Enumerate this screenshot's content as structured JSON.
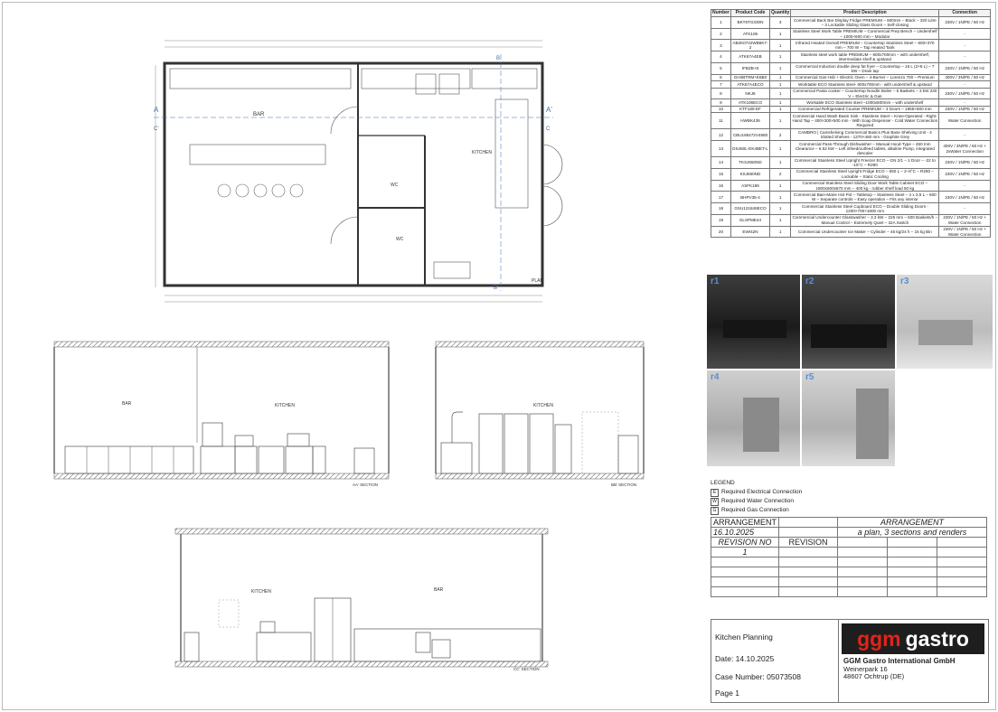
{
  "plan": {
    "label_plan": "PLAN",
    "zone_bar": "BAR",
    "zone_kitchen": "KITCHEN",
    "zone_wc1": "WC",
    "zone_wc2": "WC",
    "section_a": "A",
    "section_a2": "A'",
    "section_b": "B",
    "section_b2": "B'",
    "section_c": "C",
    "section_c2": "C'"
  },
  "sections": {
    "aa_label": "AA' SECTION",
    "aa_bar": "BAR",
    "aa_kitchen": "KITCHEN",
    "bb_label": "BB' SECTION",
    "bb_kitchen": "KITCHEN",
    "cc_label": "CC' SECTION",
    "cc_kitchen": "KITCHEN",
    "cc_bar": "BAR"
  },
  "product_table": {
    "headers": [
      "Number",
      "Product Code",
      "Quantity",
      "Product Description",
      "Connection"
    ],
    "rows": [
      [
        "1",
        "BKT6TG330N",
        "3",
        "Commercial Back Bar Display Fridge PREMIUM – 600mm – Black – 320 Litre – 3 Lockable Sliding Glass Doors – Self-closing",
        "230V / 1N/PE / 50 Hz"
      ],
      [
        "2",
        "ATK106",
        "1",
        "Stainless Steel Work Table PREMIUM – Commercial Prep Bench – Undershelf – 1000×600 mm – Modular",
        "-"
      ],
      [
        "3",
        "AB2K0742WB6K7-2",
        "1",
        "Infrared Heated Overall PREMIUM – Countertop Stainless Steel – 600×370 mm – 700 W – Tap Heated Tank",
        "-"
      ],
      [
        "4",
        "ATK67A4EB",
        "1",
        "Stainless steel work table PREMIUM – 600x700mm – with undershelf, intermediate shelf & upstand",
        "-"
      ],
      [
        "5",
        "IFBZB+8",
        "1",
        "Commercial Induction double deep fat fryer – Countertop – 16 L (2×8 L) – 7 kW – Drain tap",
        "230V / 1N/PE / 50 Hz"
      ],
      [
        "6",
        "GH4BTRM+E6B0",
        "1",
        "Commercial Gas Hob + Electric Oven – 4-Burner – Lorenzo 700 – Premium",
        "400V / 3N/PE / 50 Hz"
      ],
      [
        "7",
        "ATK67A4ECO",
        "1",
        "Worktable ECO Stainless steel- 600x700mm - with undershelf & upstand",
        "-"
      ],
      [
        "8",
        "NKJ6",
        "1",
        "Commercial Pasta cooker – Countertop Noodle Boiler – 6 Baskets – 3 kW 230 V – Electric & Gas",
        "230V / 1N/PE / 50 Hz"
      ],
      [
        "9",
        "ATK106ECO",
        "1",
        "Workable ECO Stainless steel –1000x600mm – with undershelf",
        "-"
      ],
      [
        "10",
        "KTF180-EF",
        "1",
        "Commercial Refrigerated Counter PREMIUM – 3 Doors – 1865×600 mm",
        "230V / 1N/PE / 50 Hz"
      ],
      [
        "11",
        "HWBK439",
        "1",
        "Commercial Hand Wash Basin Sink - Stainless Steel – Knee-Operated - Right-Hand Tap – 400×300×500 mm - With Soap Dispenser - Cold Water Connection Required",
        "Water Connection"
      ],
      [
        "12",
        "CBU185472V4580",
        "2",
        "CAMBRO | Camshelving Commercial Basics Plus Base Shelving Unit - 4 Slotted Shelves - 1370×460 mm - Graphite Grey",
        "-"
      ],
      [
        "13",
        "DS450L-EK4BET-L",
        "1",
        "Commercial Pass-Through Dishwasher – Manual Hood-Type – 450 mm Clearance – 6.52 kW – Left infeed/outfeed tables, alkaline Pump, integrated descaler",
        "400V / 3N/PE / 50 Hz + 2xWater Connection"
      ],
      [
        "14",
        "TKSJ650ND",
        "1",
        "Commercial Stainless Steel Upright Freezer ECO – GN 2/1 – 1 Door – -22 to -15°C – R290",
        "230V / 1N/PE / 50 Hz"
      ],
      [
        "15",
        "KSJ650ND",
        "2",
        "Commercial Stainless Steel Upright Fridge ECO – 650 L – 2–8°C – R290 – Lockable – Static Cooling",
        "230V / 1N/PE / 50 Hz"
      ],
      [
        "16",
        "ASFK186",
        "1",
        "Commercial Stainless Steel Sliding Door Work Table Cabinet ECO – 1800x600x870 mm – 400 kg - rubber shelf load 50 kg",
        "-"
      ],
      [
        "17",
        "BHPV35-4",
        "1",
        "Commercial Bain-Marie Hot Pot – Tabletop – Stainless Steel – 4 x 3.5 L – 600 W – Separate controls – Easy operation – Fits any interior",
        "230V / 1N/PE / 50 Hz"
      ],
      [
        "18",
        "GSU121846ECO",
        "1",
        "Commercial Stainless Steel Cupboard ECO – Double Sliding Doors - 1200×700×1800 mm",
        "-"
      ],
      [
        "19",
        "GLSPME44",
        "1",
        "Commercial Undercounter Glasswasher – 3.3 kW – 225 mm – 500 Baskets/h – Manual Control – Extremely Quiet – 32A Switch",
        "230V / 1N/PE / 50 Hz + Water Connection"
      ],
      [
        "20",
        "EWI42N",
        "1",
        "Commercial Undercounter Ice Maker – Cylinder – 46 kg/24 h – 15 kg Bin",
        "230V / 1N/PE / 50 Hz + Water Connection"
      ]
    ]
  },
  "renders": [
    "r1",
    "r2",
    "r3",
    "r4",
    "r5"
  ],
  "legend": {
    "title": "LEGEND",
    "items": [
      {
        "symbol": "E",
        "label": "Required Electrical Connection"
      },
      {
        "symbol": "W",
        "label": "Required Water Connection"
      },
      {
        "symbol": "G",
        "label": "Required Gas Connection"
      }
    ]
  },
  "arrangement": {
    "title_left": "ARRANGEMENT",
    "title_right": "ARRANGEMENT",
    "date": "16.10.2025",
    "description": "a plan, 3 sections and renders",
    "revision_no_header": "REVISION NO",
    "revision_header": "REVISION",
    "revision_no": "1"
  },
  "title_block": {
    "project": "Kitchen Planning",
    "date": "Date: 14.10.2025",
    "case": "Case Number: 05073508",
    "page": "Page 1",
    "logo_part1": "ggm",
    "logo_part2": "gastro",
    "company_name": "GGM Gastro International GmbH",
    "street": "Weinerpark 16",
    "city": "48607 Ochtrup (DE)"
  },
  "colors": {
    "logo_red": "#e2231a",
    "logo_bg": "#1e1e1e",
    "annotation_blue": "#3a6fb0"
  }
}
